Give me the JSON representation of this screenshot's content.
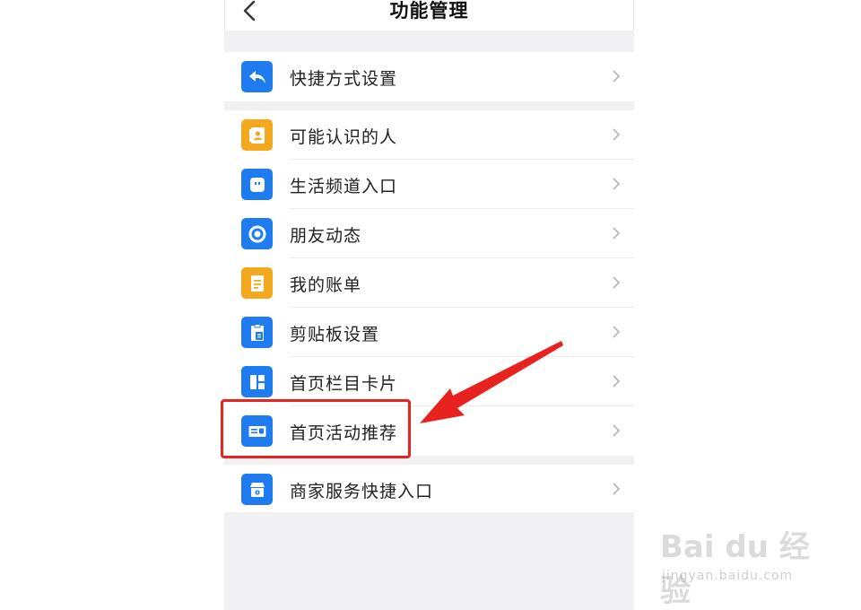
{
  "header": {
    "title": "功能管理",
    "back_icon": "chevron-left-icon"
  },
  "groups": [
    {
      "items": [
        {
          "id": "shortcut-settings",
          "label": "快捷方式设置",
          "icon": "reply-arrow-icon",
          "color": "#1f7cf0"
        }
      ]
    },
    {
      "items": [
        {
          "id": "people-you-may-know",
          "label": "可能认识的人",
          "icon": "contact-card-icon",
          "color": "#f3a81e"
        },
        {
          "id": "life-channel-entry",
          "label": "生活频道入口",
          "icon": "chat-bubble-icon",
          "color": "#1f7cf0"
        },
        {
          "id": "friends-feed",
          "label": "朋友动态",
          "icon": "ring-icon",
          "color": "#1f7cf0"
        },
        {
          "id": "my-bill",
          "label": "我的账单",
          "icon": "bill-icon",
          "color": "#f3a81e"
        },
        {
          "id": "clipboard-settings",
          "label": "剪贴板设置",
          "icon": "clipboard-icon",
          "color": "#1f7cf0"
        },
        {
          "id": "home-column-cards",
          "label": "首页栏目卡片",
          "icon": "layout-grid-icon",
          "color": "#1f7cf0"
        },
        {
          "id": "home-activity-recommend",
          "label": "首页活动推荐",
          "icon": "card-icon",
          "color": "#1f7cf0"
        }
      ]
    },
    {
      "items": [
        {
          "id": "merchant-service-entry",
          "label": "商家服务快捷入口",
          "icon": "store-icon",
          "color": "#1f7cf0"
        }
      ]
    }
  ],
  "annotation": {
    "highlight_color": "#e8231f"
  },
  "watermark": {
    "brand": "Bai du 经验",
    "url": "jingyan.baidu.com"
  }
}
